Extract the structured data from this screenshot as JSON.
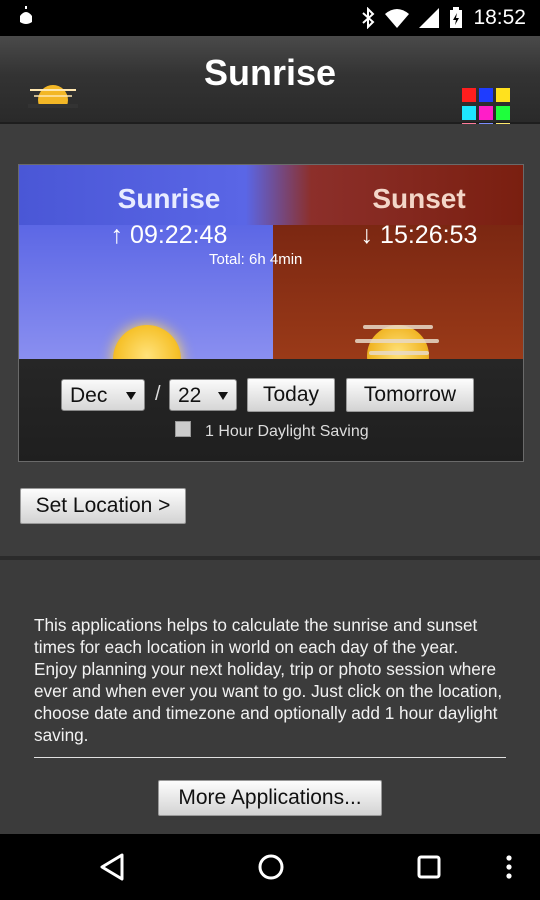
{
  "status": {
    "time": "18:52"
  },
  "header": {
    "title": "Sunrise"
  },
  "apps_grid_colors": [
    "#ff1e1e",
    "#1e3cff",
    "#ffe11e",
    "#1ee6ff",
    "#ff1ec8",
    "#1eff3c",
    "#ff7b9a",
    "#7b8cff",
    "#ffe96b"
  ],
  "card": {
    "sunrise_title": "Sunrise",
    "sunrise_time": "↑ 09:22:48",
    "sunset_title": "Sunset",
    "sunset_time": "↓ 15:26:53",
    "total": "Total: 6h 4min"
  },
  "controls": {
    "month": "Dec",
    "day": "22",
    "separator": "/",
    "today_label": "Today",
    "tomorrow_label": "Tomorrow",
    "dst_label": "1 Hour Daylight Saving",
    "dst_checked": false
  },
  "set_location_label": "Set Location >",
  "description": "This applications helps to calculate the sunrise and sunset times for each location in world on each day of the year. Enjoy planning your next holiday, trip or photo session where ever and when ever you want to go. Just click on the location, choose date and timezone and optionally add 1 hour daylight saving.",
  "more_apps_label": "More Applications..."
}
